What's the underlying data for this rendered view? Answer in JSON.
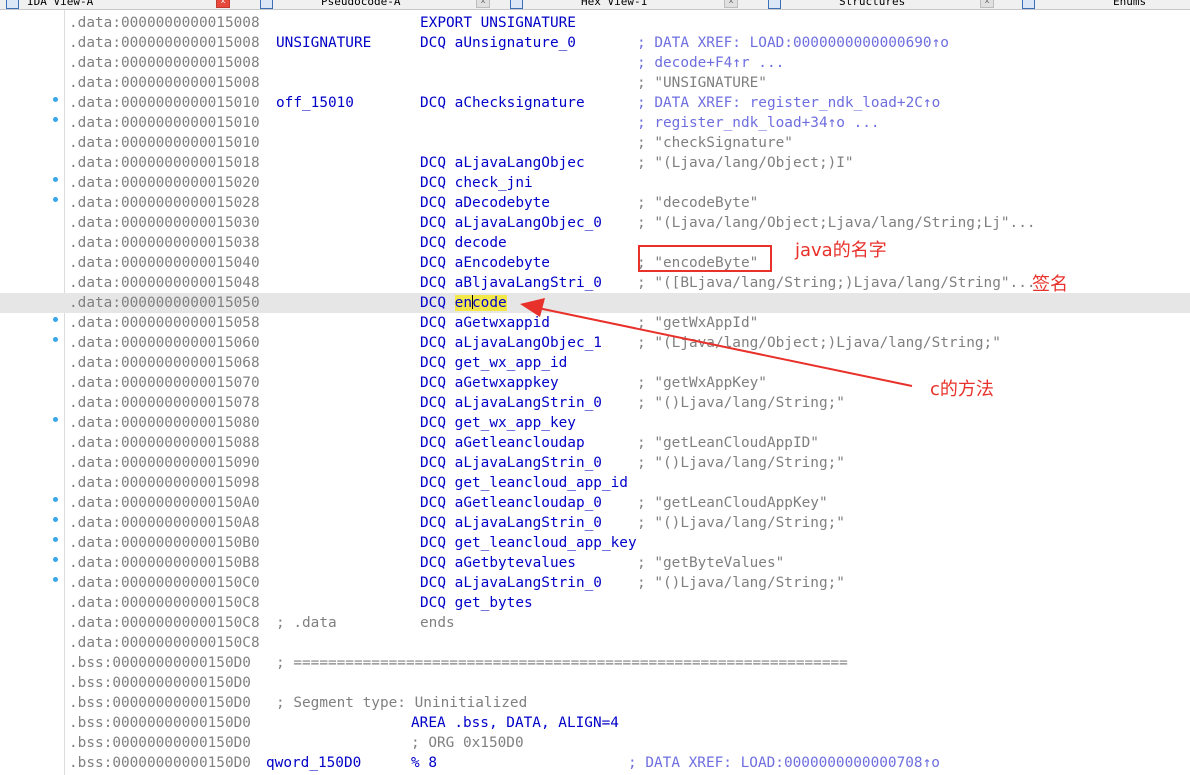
{
  "tabs": [
    {
      "label": "IDA View-A",
      "active": true
    },
    {
      "label": "Pseudocode-A",
      "active": false
    },
    {
      "label": "Hex View-1",
      "active": false
    },
    {
      "label": "Structures",
      "active": false
    },
    {
      "label": "Enums",
      "active": false
    }
  ],
  "listing": [
    {
      "addr": ".data:0000000000015008",
      "label": "",
      "instr": "EXPORT UNSIGNATURE",
      "comment": "",
      "dot": false
    },
    {
      "addr": ".data:0000000000015008",
      "label": "UNSIGNATURE",
      "op": "DCQ",
      "arg": "aUnsignature_0",
      "xref": "; DATA XREF: LOAD:0000000000000690↑o",
      "dot": false
    },
    {
      "addr": ".data:0000000000015008",
      "xref": "; decode+F4↑r ...",
      "dot": false
    },
    {
      "addr": ".data:0000000000015008",
      "comment": "; \"UNSIGNATURE\"",
      "dot": false
    },
    {
      "addr": ".data:0000000000015010",
      "label": "off_15010",
      "op": "DCQ",
      "arg": "aChecksignature",
      "xref": "; DATA XREF: register_ndk_load+2C↑o",
      "dot": true
    },
    {
      "addr": ".data:0000000000015010",
      "xref": "; register_ndk_load+34↑o ...",
      "dot": true
    },
    {
      "addr": ".data:0000000000015010",
      "comment": "; \"checkSignature\"",
      "dot": false
    },
    {
      "addr": ".data:0000000000015018",
      "op": "DCQ",
      "arg": "aLjavaLangObjec",
      "comment": "; \"(Ljava/lang/Object;)I\"",
      "dot": false
    },
    {
      "addr": ".data:0000000000015020",
      "op": "DCQ",
      "arg": "check_jni",
      "dot": true
    },
    {
      "addr": ".data:0000000000015028",
      "op": "DCQ",
      "arg": "aDecodebyte",
      "comment": "; \"decodeByte\"",
      "dot": true
    },
    {
      "addr": ".data:0000000000015030",
      "op": "DCQ",
      "arg": "aLjavaLangObjec_0",
      "comment": "; \"(Ljava/lang/Object;Ljava/lang/String;Lj\"...",
      "dot": false
    },
    {
      "addr": ".data:0000000000015038",
      "op": "DCQ",
      "arg": "decode",
      "dot": false
    },
    {
      "addr": ".data:0000000000015040",
      "op": "DCQ",
      "arg": "aEncodebyte",
      "comment": "; \"encodeByte\"",
      "dot": false
    },
    {
      "addr": ".data:0000000000015048",
      "op": "DCQ",
      "arg": "aBljavaLangStri_0",
      "comment": "; \"([BLjava/lang/String;)Ljava/lang/String\"...",
      "dot": false
    },
    {
      "addr": ".data:0000000000015050",
      "op": "DCQ",
      "arg_pre": "en",
      "arg_post": "code",
      "dot": false,
      "highlight": true
    },
    {
      "addr": ".data:0000000000015058",
      "op": "DCQ",
      "arg": "aGetwxappid",
      "comment": "; \"getWxAppId\"",
      "dot": true
    },
    {
      "addr": ".data:0000000000015060",
      "op": "DCQ",
      "arg": "aLjavaLangObjec_1",
      "comment": "; \"(Ljava/lang/Object;)Ljava/lang/String;\"",
      "dot": true
    },
    {
      "addr": ".data:0000000000015068",
      "op": "DCQ",
      "arg": "get_wx_app_id",
      "dot": false
    },
    {
      "addr": ".data:0000000000015070",
      "op": "DCQ",
      "arg": "aGetwxappkey",
      "comment": "; \"getWxAppKey\"",
      "dot": false
    },
    {
      "addr": ".data:0000000000015078",
      "op": "DCQ",
      "arg": "aLjavaLangStrin_0",
      "comment": "; \"()Ljava/lang/String;\"",
      "dot": false
    },
    {
      "addr": ".data:0000000000015080",
      "op": "DCQ",
      "arg": "get_wx_app_key",
      "dot": true
    },
    {
      "addr": ".data:0000000000015088",
      "op": "DCQ",
      "arg": "aGetleancloudap",
      "comment": "; \"getLeanCloudAppID\"",
      "dot": false
    },
    {
      "addr": ".data:0000000000015090",
      "op": "DCQ",
      "arg": "aLjavaLangStrin_0",
      "comment": "; \"()Ljava/lang/String;\"",
      "dot": false
    },
    {
      "addr": ".data:0000000000015098",
      "op": "DCQ",
      "arg": "get_leancloud_app_id",
      "dot": false
    },
    {
      "addr": ".data:00000000000150A0",
      "op": "DCQ",
      "arg": "aGetleancloudap_0",
      "comment": "; \"getLeanCloudAppKey\"",
      "dot": true
    },
    {
      "addr": ".data:00000000000150A8",
      "op": "DCQ",
      "arg": "aLjavaLangStrin_0",
      "comment": "; \"()Ljava/lang/String;\"",
      "dot": true
    },
    {
      "addr": ".data:00000000000150B0",
      "op": "DCQ",
      "arg": "get_leancloud_app_key",
      "dot": true
    },
    {
      "addr": ".data:00000000000150B8",
      "op": "DCQ",
      "arg": "aGetbytevalues",
      "comment": "; \"getByteValues\"",
      "dot": true
    },
    {
      "addr": ".data:00000000000150C0",
      "op": "DCQ",
      "arg": "aLjavaLangStrin_0",
      "comment": "; \"()Ljava/lang/String;\"",
      "dot": true
    },
    {
      "addr": ".data:00000000000150C8",
      "op": "DCQ",
      "arg": "get_bytes",
      "dot": false
    },
    {
      "addr": ".data:00000000000150C8",
      "cmt2": "; .data",
      "plain": "ends",
      "dot": false
    },
    {
      "addr": ".data:00000000000150C8",
      "dot": false
    },
    {
      "addr": ".bss:00000000000150D0",
      "cmt2": "; ================================================================",
      "dot": false,
      "bss": true
    },
    {
      "addr": ".bss:00000000000150D0",
      "dot": false,
      "bss": true
    },
    {
      "addr": ".bss:00000000000150D0",
      "cmt2": "; Segment type: Uninitialized",
      "dot": false,
      "bss": true
    },
    {
      "addr": ".bss:00000000000150D0",
      "instr2": "AREA .bss, DATA, ALIGN=4",
      "dot": false,
      "bss": true
    },
    {
      "addr": ".bss:00000000000150D0",
      "cmt3": "; ORG 0x150D0",
      "dot": false,
      "bss": true
    },
    {
      "addr": ".bss:00000000000150D0",
      "label2": "qword_150D0",
      "instr2": "% 8",
      "xref2": "; DATA XREF: LOAD:0000000000000708↑o",
      "dot": false,
      "bss": true
    }
  ],
  "annotations": {
    "java_name": "java的名字",
    "signature": "签名",
    "c_method": "c的方法"
  },
  "colors": {
    "annotation": "#e8312a",
    "address": "#808080",
    "keyword": "#0000c8",
    "xref": "#6e6ee0",
    "highlight": "#f2e84a"
  }
}
